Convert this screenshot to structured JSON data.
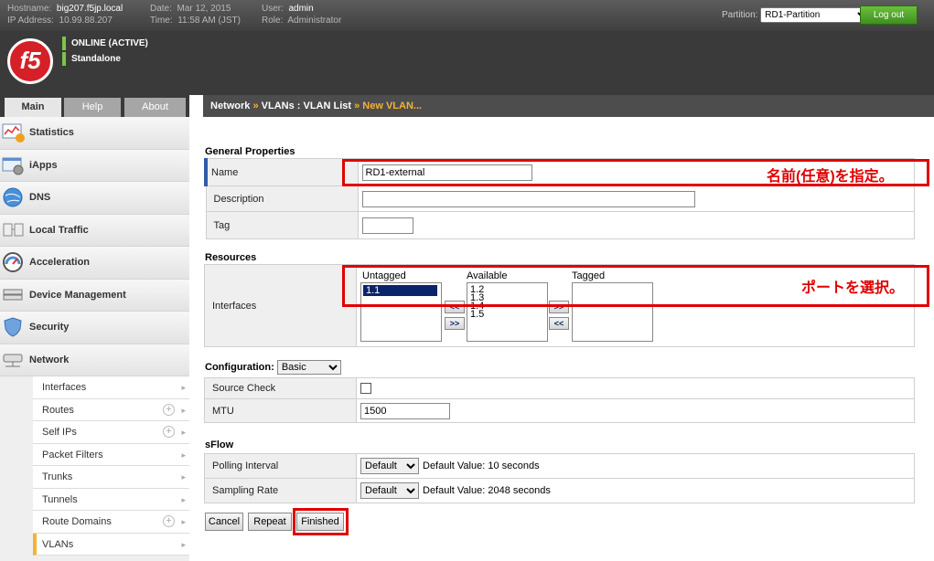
{
  "topbar": {
    "hostname_label": "Hostname:",
    "hostname": "big207.f5jp.local",
    "ip_label": "IP Address:",
    "ip": "10.99.88.207",
    "date_label": "Date:",
    "date": "Mar 12, 2015",
    "time_label": "Time:",
    "time": "11:58 AM (JST)",
    "user_label": "User:",
    "user": "admin",
    "role_label": "Role:",
    "role": "Administrator",
    "partition_label": "Partition:",
    "partition_value": "RD1-Partition",
    "logout_label": "Log out"
  },
  "header": {
    "logo_text": "f5",
    "status_line1": "ONLINE (ACTIVE)",
    "status_line2": "Standalone"
  },
  "tabs": [
    {
      "label": "Main",
      "active": true
    },
    {
      "label": "Help",
      "active": false
    },
    {
      "label": "About",
      "active": false
    }
  ],
  "breadcrumb": {
    "part1": "Network",
    "sep1": " » ",
    "part2": "VLANs : VLAN List",
    "sep2": " » ",
    "current": "New VLAN..."
  },
  "sidebar": {
    "sections": [
      {
        "label": "Statistics",
        "icon": "statistics-icon"
      },
      {
        "label": "iApps",
        "icon": "iapps-icon"
      },
      {
        "label": "DNS",
        "icon": "dns-icon"
      },
      {
        "label": "Local Traffic",
        "icon": "local-traffic-icon"
      },
      {
        "label": "Acceleration",
        "icon": "acceleration-icon"
      },
      {
        "label": "Device Management",
        "icon": "device-management-icon"
      },
      {
        "label": "Security",
        "icon": "security-icon"
      },
      {
        "label": "Network",
        "icon": "network-icon"
      }
    ],
    "network_items": [
      {
        "label": "Interfaces",
        "plus": false
      },
      {
        "label": "Routes",
        "plus": true
      },
      {
        "label": "Self IPs",
        "plus": true
      },
      {
        "label": "Packet Filters",
        "plus": false
      },
      {
        "label": "Trunks",
        "plus": false
      },
      {
        "label": "Tunnels",
        "plus": false
      },
      {
        "label": "Route Domains",
        "plus": true
      },
      {
        "label": "VLANs",
        "plus": false,
        "selected": true
      }
    ]
  },
  "general": {
    "heading": "General Properties",
    "name_label": "Name",
    "name_value": "RD1-external",
    "description_label": "Description",
    "description_value": "",
    "tag_label": "Tag",
    "tag_value": ""
  },
  "resources": {
    "heading": "Resources",
    "interfaces_label": "Interfaces",
    "untagged_label": "Untagged",
    "available_label": "Available",
    "tagged_label": "Tagged",
    "untagged_items": [
      "1.1"
    ],
    "available_items": [
      "1.2",
      "1.3",
      "1.4",
      "1.5"
    ],
    "tagged_items": [],
    "move_left": "<<",
    "move_right": ">>"
  },
  "configuration": {
    "heading": "Configuration:",
    "mode": "Basic",
    "source_check_label": "Source Check",
    "source_check": false,
    "mtu_label": "MTU",
    "mtu_value": "1500"
  },
  "sflow": {
    "heading": "sFlow",
    "polling_label": "Polling Interval",
    "polling_value": "Default",
    "polling_default_text": "Default Value: 10 seconds",
    "sampling_label": "Sampling Rate",
    "sampling_value": "Default",
    "sampling_default_text": "Default Value: 2048 seconds"
  },
  "buttons": {
    "cancel": "Cancel",
    "repeat": "Repeat",
    "finished": "Finished"
  },
  "annotations": {
    "name_note": "名前(任意)を指定。",
    "port_note": "ポートを選択。",
    "color": "#e00000"
  }
}
